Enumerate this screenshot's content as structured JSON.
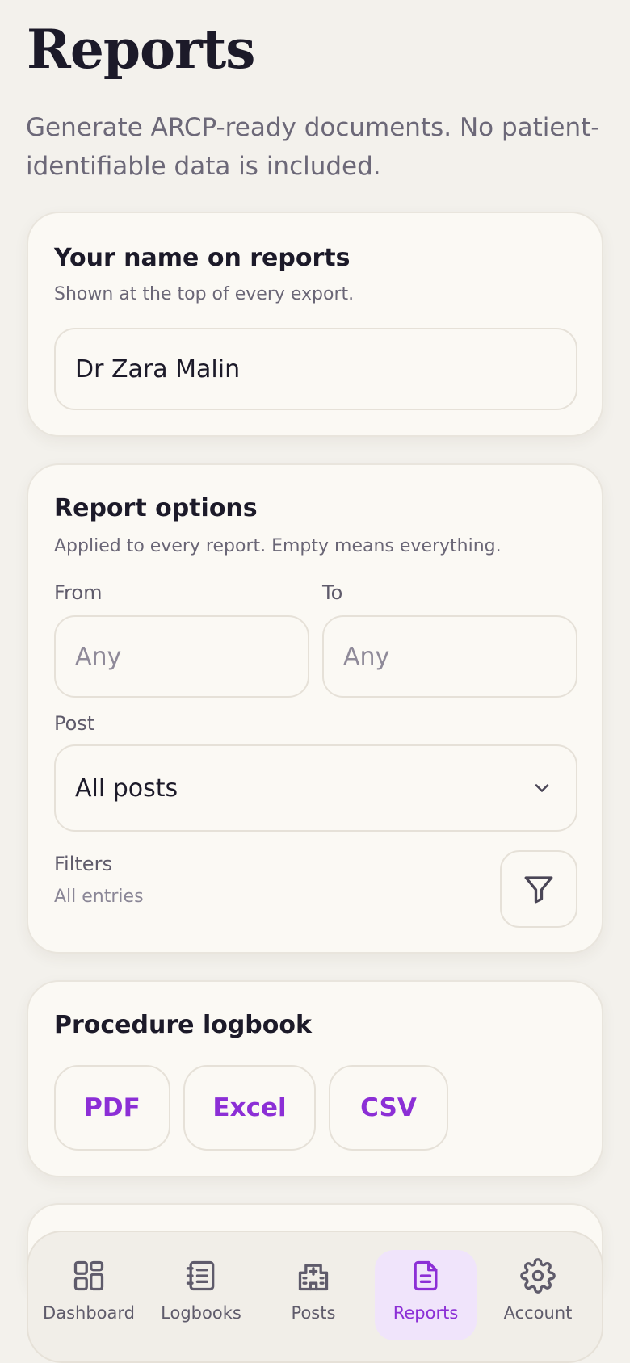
{
  "page": {
    "title": "Reports",
    "subtitle": "Generate ARCP-ready documents. No patient-identifiable data is included."
  },
  "name_card": {
    "title": "Your name on reports",
    "description": "Shown at the top of every export.",
    "name_value": "Dr Zara Malin"
  },
  "options_card": {
    "title": "Report options",
    "description": "Applied to every report. Empty means everything.",
    "from_label": "From",
    "from_value": "Any",
    "to_label": "To",
    "to_value": "Any",
    "post_label": "Post",
    "post_value": "All posts",
    "filters_label": "Filters",
    "filters_value": "All entries"
  },
  "logbook_card": {
    "title": "Procedure logbook",
    "buttons": [
      "PDF",
      "Excel",
      "CSV"
    ]
  },
  "nav": {
    "items": [
      {
        "label": "Dashboard",
        "icon": "dashboard-icon"
      },
      {
        "label": "Logbooks",
        "icon": "logbook-icon"
      },
      {
        "label": "Posts",
        "icon": "hospital-icon"
      },
      {
        "label": "Reports",
        "icon": "document-icon"
      },
      {
        "label": "Account",
        "icon": "gear-icon"
      }
    ],
    "active": "Reports"
  },
  "colors": {
    "accent": "#8c2fd6",
    "accent_bg": "#f0e4fb",
    "background": "#f3f1ec",
    "card": "#fbf9f4"
  }
}
